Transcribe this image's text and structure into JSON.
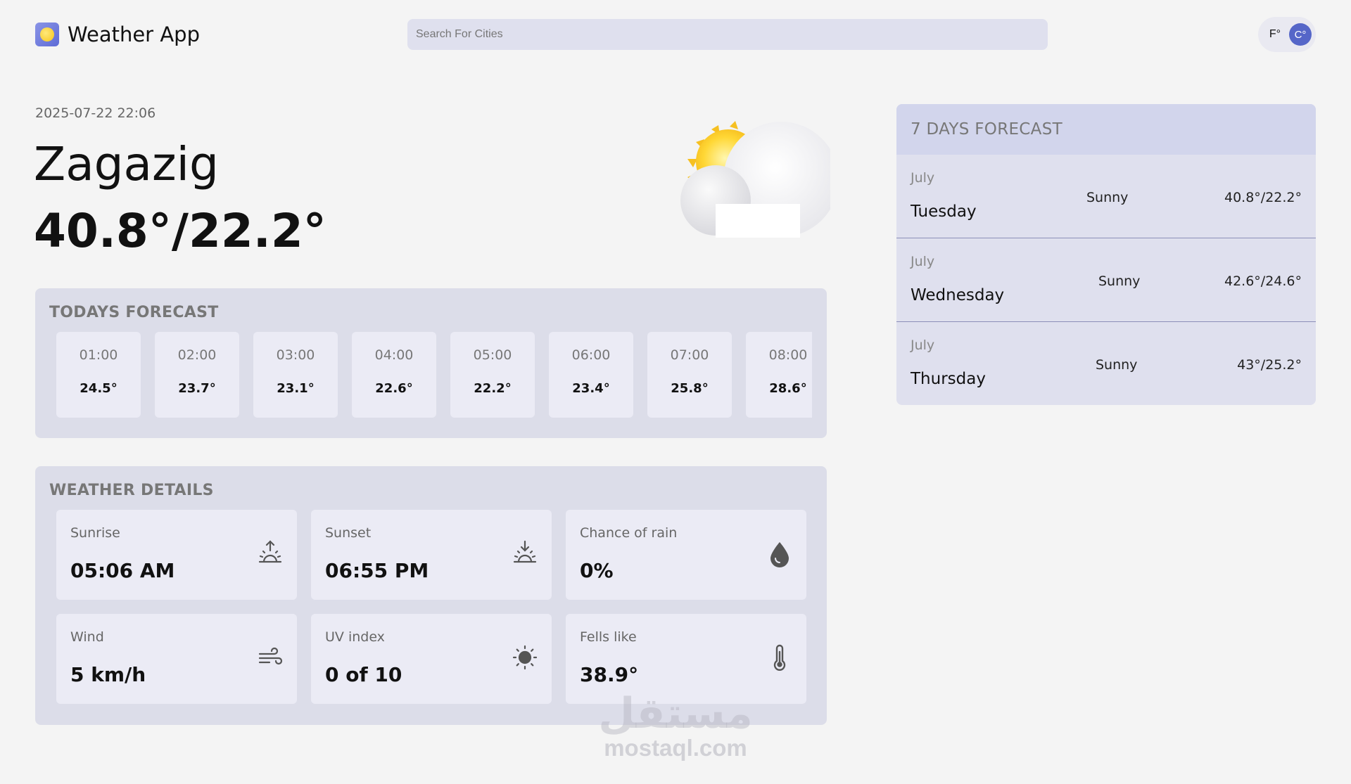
{
  "header": {
    "app_title": "Weather App",
    "search_placeholder": "Search For Cities",
    "unit_f": "F°",
    "unit_c": "C°",
    "active_unit": "C"
  },
  "current": {
    "datetime": "2025-07-22 22:06",
    "city": "Zagazig",
    "temp_range": "40.8°/22.2°",
    "icon": "sun-cloud-icon"
  },
  "today_forecast": {
    "title": "TODAYS FORECAST",
    "hours": [
      {
        "time": "01:00",
        "temp": "24.5°"
      },
      {
        "time": "02:00",
        "temp": "23.7°"
      },
      {
        "time": "03:00",
        "temp": "23.1°"
      },
      {
        "time": "04:00",
        "temp": "22.6°"
      },
      {
        "time": "05:00",
        "temp": "22.2°"
      },
      {
        "time": "06:00",
        "temp": "23.4°"
      },
      {
        "time": "07:00",
        "temp": "25.8°"
      },
      {
        "time": "08:00",
        "temp": "28.6°"
      }
    ]
  },
  "weather_details": {
    "title": "WEATHER DETAILS",
    "items": [
      {
        "label": "Sunrise",
        "value": "05:06 AM",
        "icon": "sunrise-icon"
      },
      {
        "label": "Sunset",
        "value": "06:55 PM",
        "icon": "sunset-icon"
      },
      {
        "label": "Chance of rain",
        "value": "0%",
        "icon": "raindrop-icon"
      },
      {
        "label": "Wind",
        "value": "5 km/h",
        "icon": "wind-icon"
      },
      {
        "label": "UV index",
        "value": "0 of 10",
        "icon": "uv-sun-icon"
      },
      {
        "label": "Fells like",
        "value": "38.9°",
        "icon": "thermometer-icon"
      }
    ]
  },
  "week_forecast": {
    "title": "7 DAYS FORECAST",
    "days": [
      {
        "month": "July",
        "day": "Tuesday",
        "condition": "Sunny",
        "temp": "40.8°/22.2°"
      },
      {
        "month": "July",
        "day": "Wednesday",
        "condition": "Sunny",
        "temp": "42.6°/24.6°"
      },
      {
        "month": "July",
        "day": "Thursday",
        "condition": "Sunny",
        "temp": "43°/25.2°"
      }
    ]
  },
  "watermark": {
    "arabic": "مستقل",
    "latin": "mostaql.com"
  },
  "colors": {
    "background": "#f4f4f4",
    "panel": "#dcdde9",
    "card": "#ebebf5",
    "accent": "#5566c8"
  }
}
